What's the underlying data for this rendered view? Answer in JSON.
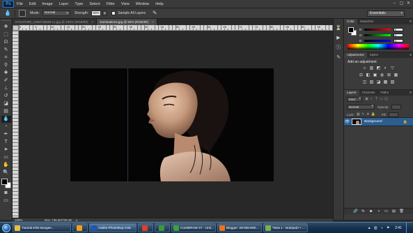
{
  "app": {
    "logo": "Ps",
    "menu": [
      "File",
      "Edit",
      "Image",
      "Layer",
      "Type",
      "Select",
      "Filter",
      "View",
      "Window",
      "Help"
    ],
    "window_controls": [
      "–",
      "▢",
      "✕"
    ]
  },
  "options_bar": {
    "mode_label": "Mode:",
    "mode_value": "Normal",
    "strength_label": "Strength:",
    "strength_value": "50%",
    "sample_all_layers_label": "Sample All Layers",
    "sample_all_layers_checked": false,
    "workspace": "Essentials"
  },
  "documents": {
    "tabs": [
      {
        "label": "070137300_1409742639-c1.jpg @ 100% (RGB/8#)",
        "active": false
      },
      {
        "label": "Dominations.jpg @ 50% (RGB/8#)",
        "active": true
      }
    ],
    "close_glyph": "×"
  },
  "rulers": {
    "top_labels": [
      "0",
      "5",
      "10",
      "15",
      "20",
      "25",
      "30",
      "35",
      "40",
      "45",
      "50",
      "55",
      "60",
      "65",
      "70",
      "75",
      "80",
      "85",
      "90",
      "95"
    ]
  },
  "status": {
    "zoom": "100%",
    "doc_info": "Doc: 736.4K/736.4K",
    "arrow": "▸"
  },
  "tools": [
    {
      "name": "move-tool",
      "glyph": "✥"
    },
    {
      "name": "marquee-tool",
      "glyph": "⬚"
    },
    {
      "name": "lasso-tool",
      "glyph": "ᘏ"
    },
    {
      "name": "quick-select-tool",
      "glyph": "✎"
    },
    {
      "name": "crop-tool",
      "glyph": "⌗"
    },
    {
      "name": "eyedropper-tool",
      "glyph": "⚲"
    },
    {
      "name": "healing-tool",
      "glyph": "✚"
    },
    {
      "name": "brush-tool",
      "glyph": "✐"
    },
    {
      "name": "clone-stamp-tool",
      "glyph": "⊥"
    },
    {
      "name": "history-brush-tool",
      "glyph": "↺"
    },
    {
      "name": "eraser-tool",
      "glyph": "◪"
    },
    {
      "name": "gradient-tool",
      "glyph": "▤"
    },
    {
      "name": "blur-tool",
      "glyph": "💧",
      "selected": true
    },
    {
      "name": "dodge-tool",
      "glyph": "◔"
    },
    {
      "name": "pen-tool",
      "glyph": "✒"
    },
    {
      "name": "type-tool",
      "glyph": "T"
    },
    {
      "name": "path-select-tool",
      "glyph": "➤"
    },
    {
      "name": "shape-tool",
      "glyph": "▭"
    },
    {
      "name": "hand-tool",
      "glyph": "✋"
    },
    {
      "name": "zoom-tool",
      "glyph": "🔍"
    }
  ],
  "right_strip_icons": [
    "history-icon",
    "actions-icon",
    "info-icon",
    "brush-preset-icon"
  ],
  "color_panel": {
    "tabs": [
      "Color",
      "Swatches"
    ],
    "channels": [
      {
        "label": "R",
        "value": "0"
      },
      {
        "label": "G",
        "value": "0"
      },
      {
        "label": "B",
        "value": "0"
      }
    ],
    "foreground": "#000000",
    "background": "#ffffff"
  },
  "adjustments_panel": {
    "tabs": [
      "Adjustments",
      "Styles"
    ],
    "title": "Add an adjustment",
    "row1": [
      "☼",
      "▥",
      "◩",
      "◐",
      "▽"
    ],
    "row2": [
      "⚖",
      "◧",
      "▣",
      "◍",
      "⊞",
      "▦"
    ],
    "row3": [
      "◫",
      "▨",
      "◪",
      "▩",
      "▧"
    ]
  },
  "layers_panel": {
    "tabs": [
      "Layers",
      "Channels",
      "Paths"
    ],
    "filter_label": "Kind",
    "blend_mode": "Normal",
    "opacity_label": "Opacity:",
    "lock_label": "Lock:",
    "fill_label": "Fill:",
    "layer_name": "Background",
    "footer_icons": [
      "🔗",
      "fx",
      "◙",
      "◑",
      "▭",
      "▤",
      "🗑"
    ]
  },
  "taskbar": {
    "items": [
      {
        "label": "Tutorial  Efek Bungee...",
        "color": "#e8c040",
        "active": false
      },
      {
        "label": "",
        "color": "#f0a020",
        "active": false,
        "icon_only": true
      },
      {
        "label": "Adobe Photoshop CS6",
        "color": "#1e5aa8",
        "active": true
      },
      {
        "label": "",
        "color": "#e0402a",
        "active": false,
        "icon_only": true
      },
      {
        "label": "",
        "color": "#3a9a3a",
        "active": false,
        "icon_only": true
      },
      {
        "label": "CorelDRAW X7 - Unti...",
        "color": "#3aa040",
        "active": false
      },
      {
        "label": "Blogger: WANDAWE...",
        "color": "#f07020",
        "active": false
      },
      {
        "label": "*New 1 - Notepad++ ...",
        "color": "#78b050",
        "active": false
      }
    ],
    "clock": "2:41"
  }
}
